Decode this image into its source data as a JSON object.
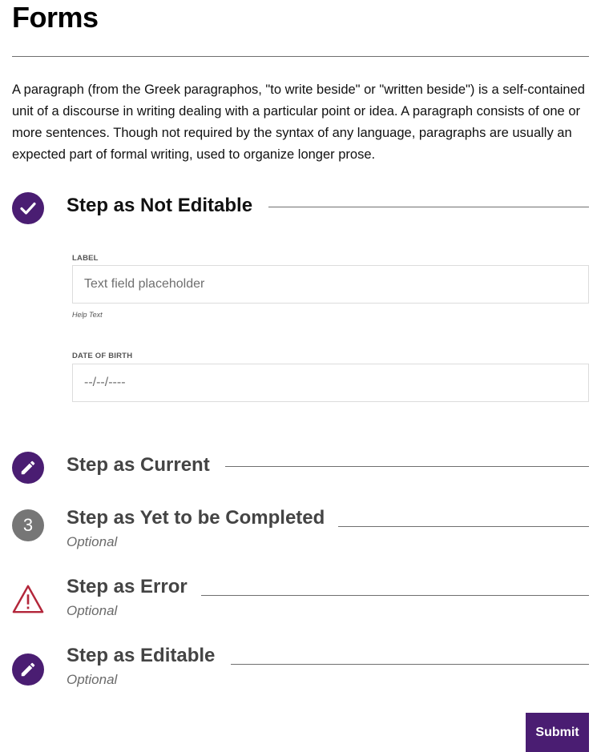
{
  "page": {
    "title": "Forms",
    "intro": "A paragraph (from the Greek paragraphos, \"to write beside\" or \"written beside\") is a self-contained unit of a discourse in writing dealing with a particular point or idea. A paragraph consists of one or more sentences. Though not required by the syntax of any language, paragraphs are usually an expected part of formal writing, used to organize longer prose."
  },
  "colors": {
    "accent": "#4a1d72",
    "pending": "#767676",
    "error": "#b3263a",
    "rule": "#6f6f6f"
  },
  "steps": [
    {
      "title": "Step as Not Editable",
      "state": "completed",
      "icon": "check-icon"
    },
    {
      "title": "Step as Current",
      "state": "current",
      "icon": "pencil-icon"
    },
    {
      "title": "Step as Yet to be Completed",
      "state": "pending",
      "icon": "number-icon",
      "number": "3",
      "optional": "Optional"
    },
    {
      "title": "Step as Error",
      "state": "error",
      "icon": "warning-icon",
      "optional": "Optional"
    },
    {
      "title": "Step as Editable",
      "state": "editable",
      "icon": "pencil-icon",
      "optional": "Optional"
    }
  ],
  "form": {
    "text_field": {
      "label": "LABEL",
      "placeholder": "Text field placeholder",
      "help": "Help Text"
    },
    "date_field": {
      "label": "DATE OF BIRTH",
      "placeholder": "--/--/----"
    }
  },
  "actions": {
    "submit_label": "Submit"
  }
}
